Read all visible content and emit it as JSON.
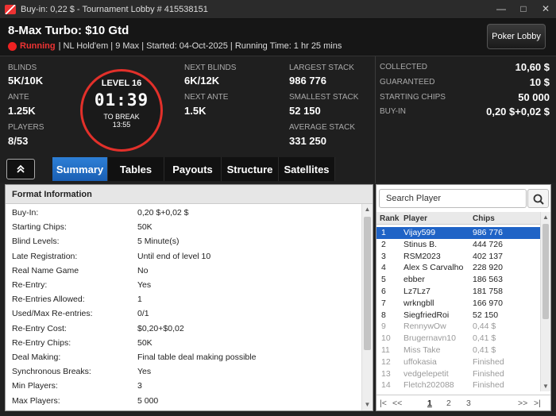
{
  "titlebar": {
    "title": "Buy-in: 0,22 $ - Tournament Lobby # 415538151",
    "minimize": "—",
    "maximize": "□",
    "close": "✕"
  },
  "header": {
    "tournament_name": "8-Max Turbo: $10 Gtd",
    "status": "Running",
    "details": "| NL Hold'em | 9 Max | Started: 04-Oct-2025 | Running Time: 1 hr  25 mins",
    "lobby_button": "Poker Lobby"
  },
  "stats": {
    "blinds_label": "BLINDS",
    "blinds": "5K/10K",
    "ante_label": "ANTE",
    "ante": "1.25K",
    "players_label": "PLAYERS",
    "players": "8/53",
    "clock": {
      "level": "LEVEL 16",
      "time": "01:39",
      "to_break_label": "TO BREAK",
      "to_break": "13:55"
    },
    "next_blinds_label": "NEXT BLINDS",
    "next_blinds": "6K/12K",
    "next_ante_label": "NEXT ANTE",
    "next_ante": "1.5K",
    "largest_stack_label": "LARGEST STACK",
    "largest_stack": "986 776",
    "smallest_stack_label": "SMALLEST STACK",
    "smallest_stack": "52 150",
    "average_stack_label": "AVERAGE STACK",
    "average_stack": "331 250"
  },
  "prize": {
    "collected_label": "COLLECTED",
    "collected": "10,60 $",
    "guaranteed_label": "GUARANTEED",
    "guaranteed": "10 $",
    "starting_chips_label": "STARTING CHIPS",
    "starting_chips": "50 000",
    "buyin_label": "BUY-IN",
    "buyin": "0,20 $+0,02 $"
  },
  "tabs": [
    "Summary",
    "Tables",
    "Payouts",
    "Structure",
    "Satellites"
  ],
  "format": {
    "title": "Format Information",
    "rows": [
      {
        "label": "Buy-In:",
        "value": "0,20 $+0,02 $"
      },
      {
        "label": "Starting Chips:",
        "value": "50K"
      },
      {
        "label": "Blind Levels:",
        "value": "5 Minute(s)"
      },
      {
        "label": "Late Registration:",
        "value": "Until end of level 10"
      },
      {
        "label": "Real Name Game",
        "value": "No"
      },
      {
        "label": "Re-Entry:",
        "value": "Yes"
      },
      {
        "label": "Re-Entries Allowed:",
        "value": "1"
      },
      {
        "label": "Used/Max Re-entries:",
        "value": "0/1"
      },
      {
        "label": "Re-Entry Cost:",
        "value": "$0,20+$0,02"
      },
      {
        "label": "Re-Entry Chips:",
        "value": "50K"
      },
      {
        "label": "Deal Making:",
        "value": "Final table deal making possible"
      },
      {
        "label": "Synchronous Breaks:",
        "value": "Yes"
      },
      {
        "label": "Min Players:",
        "value": "3"
      },
      {
        "label": "Max Players:",
        "value": "5 000"
      }
    ]
  },
  "players_panel": {
    "search_placeholder": "Search Player",
    "col_rank": "Rank",
    "col_player": "Player",
    "col_chips": "Chips",
    "rows": [
      {
        "rank": "1",
        "player": "Vijay599",
        "chips": "986 776"
      },
      {
        "rank": "2",
        "player": "Stinus B.",
        "chips": "444 726"
      },
      {
        "rank": "3",
        "player": "RSM2023",
        "chips": "402 137"
      },
      {
        "rank": "4",
        "player": "Alex S Carvalho",
        "chips": "228 920"
      },
      {
        "rank": "5",
        "player": "ebber",
        "chips": "186 563"
      },
      {
        "rank": "6",
        "player": "Lz7Lz7",
        "chips": "181 758"
      },
      {
        "rank": "7",
        "player": "wrkngbll",
        "chips": "166 970"
      },
      {
        "rank": "8",
        "player": "SiegfriedRoi",
        "chips": "52 150"
      },
      {
        "rank": "9",
        "player": "RennywOw",
        "chips": "0,44 $"
      },
      {
        "rank": "10",
        "player": "Brugernavn10",
        "chips": "0,41 $"
      },
      {
        "rank": "11",
        "player": "Miss Take",
        "chips": "0,41 $"
      },
      {
        "rank": "12",
        "player": "uffokasia",
        "chips": "Finished"
      },
      {
        "rank": "13",
        "player": "vedgelepetit",
        "chips": "Finished"
      },
      {
        "rank": "14",
        "player": "Fletch202088",
        "chips": "Finished"
      }
    ],
    "pages": [
      "1",
      "2",
      "3"
    ],
    "first": "|<",
    "prev": "<<",
    "next": ">>",
    "last": ">|"
  }
}
